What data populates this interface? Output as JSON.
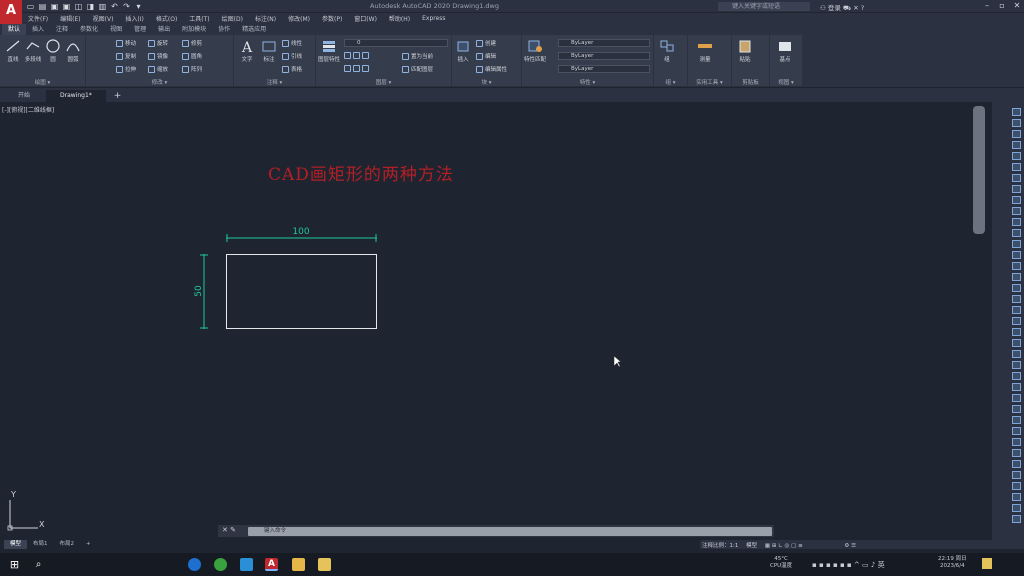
{
  "app": {
    "logo_letter": "A",
    "title": "Autodesk AutoCAD 2020   Drawing1.dwg",
    "search_placeholder": "键入关键字或短语",
    "user": "登录"
  },
  "menubar": [
    "文件(F)",
    "编辑(E)",
    "视图(V)",
    "插入(I)",
    "格式(O)",
    "工具(T)",
    "绘图(D)",
    "标注(N)",
    "修改(M)",
    "参数(P)",
    "窗口(W)",
    "帮助(H)",
    "Express"
  ],
  "ribbon_tabs": [
    {
      "label": "默认",
      "active": true
    },
    {
      "label": "插入",
      "active": false
    },
    {
      "label": "注释",
      "active": false
    },
    {
      "label": "参数化",
      "active": false
    },
    {
      "label": "视图",
      "active": false
    },
    {
      "label": "管理",
      "active": false
    },
    {
      "label": "输出",
      "active": false
    },
    {
      "label": "附加模块",
      "active": false
    },
    {
      "label": "协作",
      "active": false
    },
    {
      "label": "精选应用",
      "active": false
    }
  ],
  "ribbon": {
    "draw": {
      "line": "直线",
      "polyline": "多段线",
      "circle": "圆",
      "arc": "圆弧",
      "title": "绘图 ▾"
    },
    "modify": {
      "move": "移动",
      "rotate": "旋转",
      "trim": "修剪",
      "copy": "复制",
      "mirror": "镜像",
      "fillet": "圆角",
      "stretch": "拉伸",
      "scale": "缩放",
      "array": "阵列",
      "title": "修改 ▾"
    },
    "annotation": {
      "text": "文字",
      "dimension": "标注",
      "linear": "线性",
      "leader": "引线",
      "table": "表格",
      "title": "注释 ▾"
    },
    "layers": {
      "layer_props": "图层特性",
      "current_layer": "0",
      "make_current": "置为当前",
      "match_layer": "匹配图层",
      "title": "图层 ▾"
    },
    "block": {
      "insert": "插入",
      "create": "创建",
      "edit": "编辑",
      "edit_attr": "编辑属性",
      "title": "块 ▾"
    },
    "properties": {
      "match": "特性匹配",
      "color": "ByLayer",
      "linetype": "ByLayer",
      "lineweight": "ByLayer",
      "title": "特性 ▾"
    },
    "groups": {
      "group": "组",
      "title": "组 ▾"
    },
    "utilities": {
      "measure": "测量",
      "title": "实用工具 ▾"
    },
    "clipboard": {
      "paste": "粘贴",
      "title": "剪贴板"
    },
    "view": {
      "base": "基点",
      "title": "视图 ▾"
    }
  },
  "doc_tabs": [
    {
      "label": "开始",
      "active": false
    },
    {
      "label": "Drawing1*",
      "active": true
    }
  ],
  "viewport_label": "[-][俯视][二维线框]",
  "drawing": {
    "title_text": "CAD画矩形的两种方法",
    "title_color": "#b41f25",
    "dimension_color": "#1fc7a0",
    "rect_width": 100,
    "rect_height": 50,
    "width_label": "100",
    "height_label": "50",
    "ucs_x": "X",
    "ucs_y": "Y"
  },
  "command": {
    "placeholder": "键入命令"
  },
  "layout_tabs": [
    {
      "label": "模型",
      "active": true
    },
    {
      "label": "布局1",
      "active": false
    },
    {
      "label": "布局2",
      "active": false
    }
  ],
  "status": {
    "scale": "注释比例：1:1",
    "model": "模型"
  },
  "taskbar": {
    "temp": "45°C",
    "cpu": "CPU温度",
    "time": "22:19 周日",
    "date": "2023/6/4"
  }
}
